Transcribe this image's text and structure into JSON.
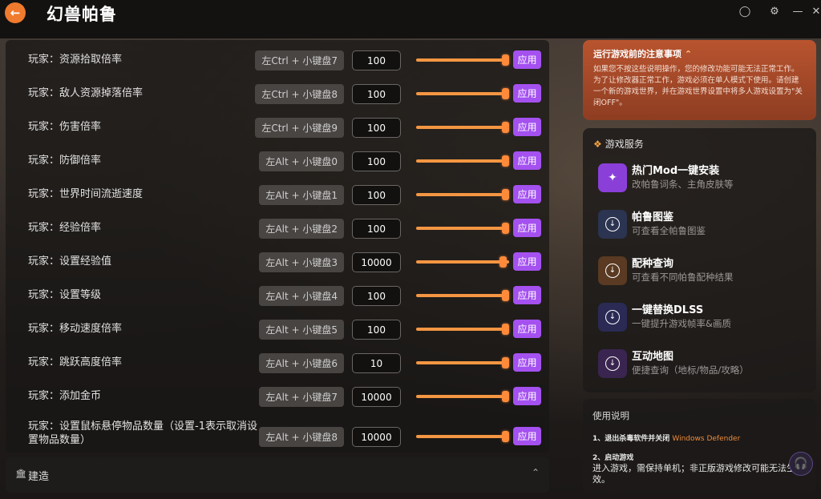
{
  "app": {
    "title": "幻兽帕鲁",
    "back_icon": "arrow-left-icon",
    "accent": "#f07a2e"
  },
  "cheats": {
    "apply_label": "应用",
    "rows": [
      {
        "label": "玩家：资源拾取倍率",
        "hotkey": "左Ctrl + 小键盘7",
        "value": "100",
        "slider": 1.0
      },
      {
        "label": "玩家：敌人资源掉落倍率",
        "hotkey": "左Ctrl + 小键盘8",
        "value": "100",
        "slider": 1.0
      },
      {
        "label": "玩家：伤害倍率",
        "hotkey": "左Ctrl + 小键盘9",
        "value": "100",
        "slider": 1.0
      },
      {
        "label": "玩家：防御倍率",
        "hotkey": "左Alt + 小键盘0",
        "value": "100",
        "slider": 1.0
      },
      {
        "label": "玩家：世界时间流逝速度",
        "hotkey": "左Alt + 小键盘1",
        "value": "100",
        "slider": 1.0
      },
      {
        "label": "玩家：经验倍率",
        "hotkey": "左Alt + 小键盘2",
        "value": "100",
        "slider": 1.0
      },
      {
        "label": "玩家：设置经验值",
        "hotkey": "左Alt + 小键盘3",
        "value": "10000",
        "slider": 0.97
      },
      {
        "label": "玩家：设置等级",
        "hotkey": "左Alt + 小键盘4",
        "value": "100",
        "slider": 1.0
      },
      {
        "label": "玩家：移动速度倍率",
        "hotkey": "左Alt + 小键盘5",
        "value": "100",
        "slider": 1.0
      },
      {
        "label": "玩家：跳跃高度倍率",
        "hotkey": "左Alt + 小键盘6",
        "value": "10",
        "slider": 1.0
      },
      {
        "label": "玩家：添加金币",
        "hotkey": "左Alt + 小键盘7",
        "value": "10000",
        "slider": 1.0
      },
      {
        "label": "玩家：设置鼠标悬停物品数量（设置-1表示取消设置物品数量）",
        "hotkey": "左Alt + 小键盘8",
        "value": "10000",
        "slider": 1.0
      }
    ]
  },
  "build": {
    "label": "建造",
    "icon": "building-icon",
    "chevron": "chevron-up-icon"
  },
  "notice": {
    "title": "运行游戏前的注意事项",
    "body": "如果您不按这些说明操作，您的修改功能可能无法正常工作。为了让修改器正常工作，游戏必须在单人模式下使用。请创建一个新的游戏世界，并在游戏世界设置中将多人游戏设置为\"关闭OFF\"。"
  },
  "services": {
    "header": "游戏服务",
    "items": [
      {
        "title": "热门Mod一键安装",
        "subtitle": "改帕鲁词条、主角皮肤等",
        "icon": "puzzle-icon",
        "color": "#8b3fd9"
      },
      {
        "title": "帕鲁图鉴",
        "subtitle": "可查看全帕鲁图鉴",
        "icon": "download-icon",
        "color": "#2b3450"
      },
      {
        "title": "配种查询",
        "subtitle": "可查看不同帕鲁配种结果",
        "icon": "download-icon",
        "color": "#5a3a22"
      },
      {
        "title": "一键替换DLSS",
        "subtitle": "一键提升游戏帧率&画质",
        "icon": "download-icon",
        "color": "#2a2a55"
      },
      {
        "title": "互动地图",
        "subtitle": "便捷查询（地标/物品/攻略）",
        "icon": "download-icon",
        "color": "#3a2550"
      }
    ]
  },
  "instructions": {
    "title": "使用说明",
    "step1_prefix": "1、退出杀毒软件并关闭",
    "step1_highlight": "Windows Defender",
    "step2_title": "2、启动游戏",
    "step2_body": "进入游戏，需保持单机；非正版游戏修改可能无法生效。"
  }
}
